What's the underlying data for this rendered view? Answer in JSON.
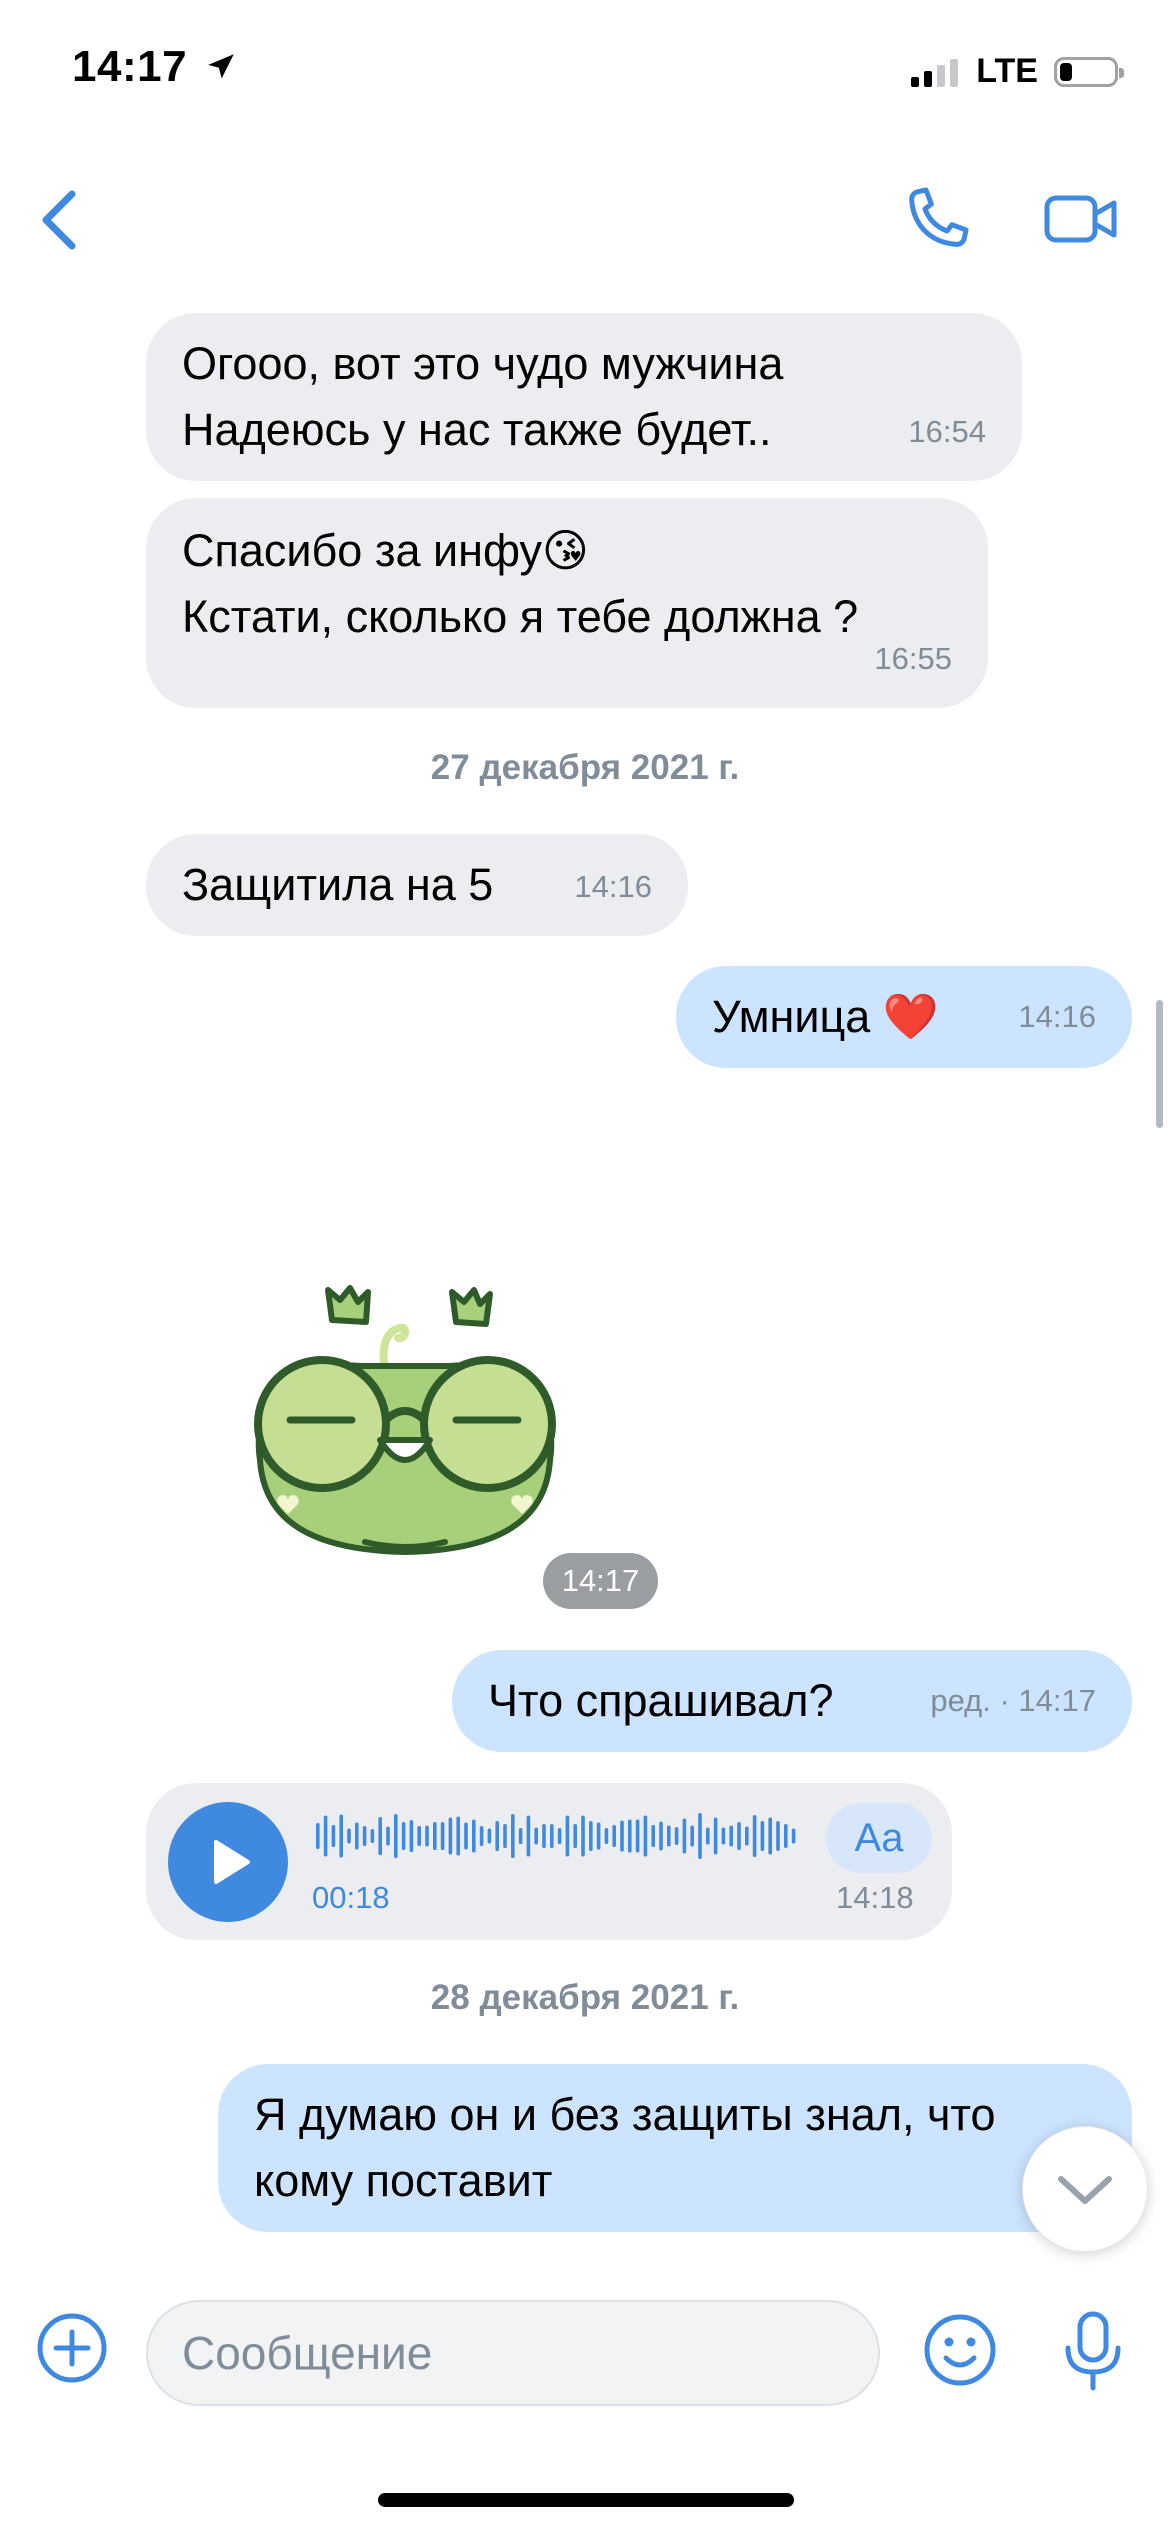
{
  "status_bar": {
    "time": "14:17",
    "network": "LTE"
  },
  "header": {
    "back_icon": "chevron-left-icon",
    "call_icon": "phone-icon",
    "video_icon": "video-camera-icon",
    "accent": "#3f8ae0"
  },
  "messages": [
    {
      "dir": "in",
      "text": "Огооо, вот это чудо мужчина\nНадеюсь у нас также будет..",
      "time": "16:54"
    },
    {
      "dir": "in",
      "text": "Спасибо за инфу😘\nКстати, сколько я тебе должна ?",
      "time": "16:55"
    },
    {
      "dir": "in",
      "text": "Защитила на 5",
      "time": "14:16"
    },
    {
      "dir": "out",
      "text": "Умница ❤️",
      "time": "14:16"
    },
    {
      "dir": "in",
      "type": "sticker",
      "sticker": "frog-sticker",
      "time": "14:17"
    },
    {
      "dir": "out",
      "text": "Что спрашивал?",
      "edited": "ред.",
      "time": "14:17"
    },
    {
      "dir": "in",
      "type": "voice",
      "duration": "00:18",
      "transcribe_label": "Aa",
      "time": "14:18"
    },
    {
      "dir": "out",
      "text": "Я думаю он и без защиты знал, что\nкому поставит"
    }
  ],
  "date_separators": [
    "27 декабря 2021 г.",
    "28 декабря 2021 г."
  ],
  "composer": {
    "placeholder": "Сообщение"
  },
  "colors": {
    "incoming_bubble": "#ebedf0",
    "outgoing_bubble": "#cce4ff",
    "meta_text": "#818c99"
  }
}
